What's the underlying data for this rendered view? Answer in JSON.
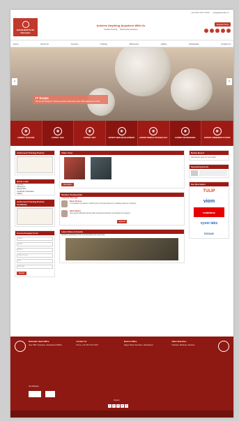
{
  "topbar": {
    "phone": "+91 9XX XXX XXXX",
    "email": "info@dehradun.in"
  },
  "header": {
    "logo_title": "NAVIN INSTITUTE",
    "logo_sub": "Dehradun",
    "tagline": "Achieve Anything Anywhere With Us",
    "mini_links": [
      "Certified Training",
      "Placements Assistance"
    ],
    "cta": "Enquire Now"
  },
  "nav": {
    "items": [
      "Home",
      "About Us",
      "Courses",
      "Training",
      "Placement",
      "Gallery",
      "Downloads",
      "Contact Us"
    ]
  },
  "hero": {
    "title": "IT Scope",
    "desc": "We are the leading IT training institute of Dehradun with 100% placement record."
  },
  "services": [
    {
      "label": "EXPERT TELECOM",
      "icon": "tower-icon"
    },
    {
      "label": "EXPERT JAVA",
      "icon": "code-icon"
    },
    {
      "label": "EXPERT .NET",
      "icon": "net-icon"
    },
    {
      "label": "EXPERT WEB DEVELOPMENT",
      "icon": "web-icon"
    },
    {
      "label": "EXPERT MOBILE TECHNOLOGY",
      "icon": "mobile-icon"
    },
    {
      "label": "EXPERT NETWORKING",
      "icon": "network-icon"
    },
    {
      "label": "EXPERT EMBEDDED SYSTEM",
      "icon": "chip-icon"
    }
  ],
  "left": {
    "cert_title": "Authorised Training Partner",
    "links_title": "Quick Links",
    "links": [
      "Courses",
      "Placement",
      "Registration",
      "Certificate Verification",
      "Gallery"
    ],
    "cert2_title": "Authorised Training Partner Certificate",
    "form_title": "Course Enquiry Form",
    "fields": [
      "Name",
      "Email",
      "Phone",
      "Select Course",
      "City",
      "Message"
    ],
    "submit": "Submit"
  },
  "mid": {
    "video_title": "Video Zone",
    "more": "View More",
    "test_title": "Student Testimonials",
    "chair": "Chairman Message",
    "t1_name": "Navin Sharma",
    "t1_text": "I completed my telecom training here and got placed in a leading telecom company.",
    "t2_name": "Rahul Rawat",
    "t2_text": "Very good practical training with experienced faculty and placement support.",
    "view_all": "View All",
    "news_title": "Latest News & Events",
    "news_item": "Students felicitated at the annual placement ceremony."
  },
  "right": {
    "news_title": "Notice Board",
    "news_line": "Admissions open for new batch",
    "events_title": "Upcoming Events",
    "partners_title": "Our Recruiters",
    "partners": [
      "TULIP",
      "viom",
      "vodafone",
      "vyom labs",
      "ESSAR"
    ]
  },
  "footer": {
    "cols": [
      {
        "h": "Dehradun Head Office",
        "t": "Near ISBT, Dehradun, Uttarakhand 248001"
      },
      {
        "h": "Contact Us",
        "t": "Phone: +91 9XX XXX XXXX"
      },
      {
        "h": "Branch Office",
        "t": "Rajpur Road, Dehradun, Uttarakhand"
      },
      {
        "h": "Other Branches",
        "t": "Haridwar, Rishikesh, Roorkee"
      }
    ],
    "partners_label": "Our Partners",
    "counter_label": "Visitors",
    "counter": [
      "1",
      "2",
      "3",
      "4",
      "6"
    ]
  },
  "colors": {
    "brand": "#9e1b15",
    "accent": "#c0392b"
  }
}
